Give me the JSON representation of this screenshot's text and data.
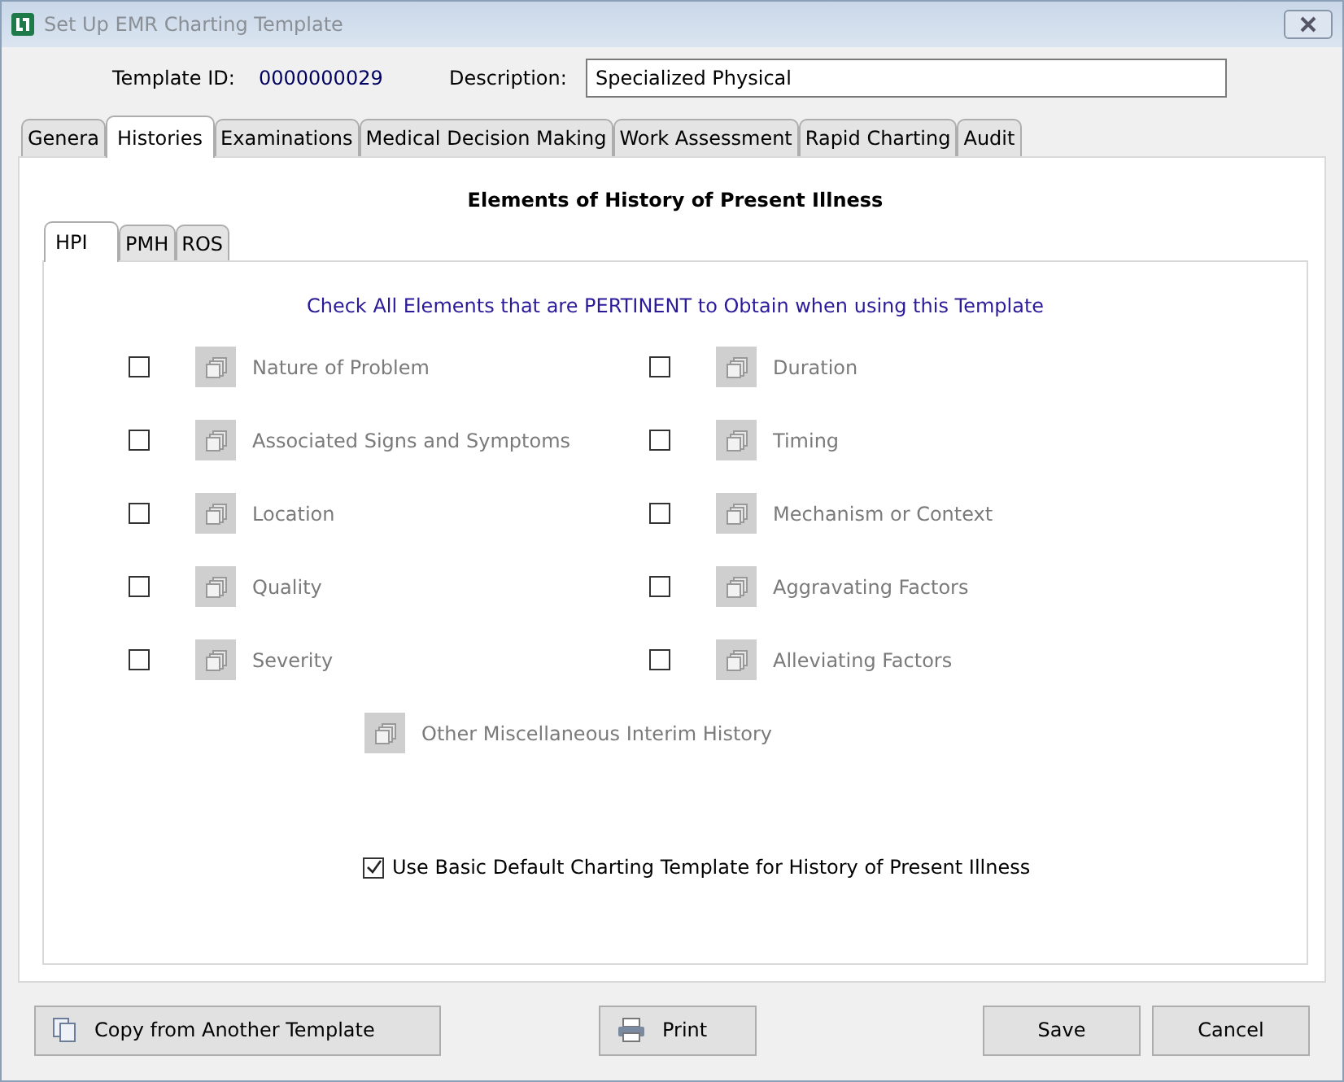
{
  "window": {
    "title": "Set Up EMR Charting Template"
  },
  "header": {
    "template_id_label": "Template ID:",
    "template_id": "0000000029",
    "description_label": "Description:",
    "description": "Specialized Physical"
  },
  "tabs": [
    {
      "label": "Genera",
      "selected": false
    },
    {
      "label": "Histories",
      "selected": true
    },
    {
      "label": "Examinations",
      "selected": false
    },
    {
      "label": "Medical Decision Making",
      "selected": false
    },
    {
      "label": "Work Assessment",
      "selected": false
    },
    {
      "label": "Rapid Charting",
      "selected": false
    },
    {
      "label": "Audit",
      "selected": false
    }
  ],
  "section_title": "Elements of History of Present Illness",
  "subtabs": [
    {
      "label": "HPI",
      "selected": true
    },
    {
      "label": "PMH",
      "selected": false
    },
    {
      "label": "ROS",
      "selected": false
    }
  ],
  "instruction": "Check All Elements that are PERTINENT to Obtain when using this Template",
  "elements": [
    {
      "label": "Nature of Problem",
      "checked": false
    },
    {
      "label": "Duration",
      "checked": false
    },
    {
      "label": "Associated Signs and Symptoms",
      "checked": false
    },
    {
      "label": "Timing",
      "checked": false
    },
    {
      "label": "Location",
      "checked": false
    },
    {
      "label": "Mechanism or Context",
      "checked": false
    },
    {
      "label": "Quality",
      "checked": false
    },
    {
      "label": "Aggravating Factors",
      "checked": false
    },
    {
      "label": "Severity",
      "checked": false
    },
    {
      "label": "Alleviating Factors",
      "checked": false
    }
  ],
  "other_element": {
    "label": "Other Miscellaneous Interim History"
  },
  "default_option": {
    "label": "Use Basic Default Charting Template for History of Present Illness",
    "checked": true
  },
  "buttons": [
    {
      "kind": "copy",
      "label": "Copy from Another Template"
    },
    {
      "kind": "print",
      "label": "Print"
    },
    {
      "kind": "save",
      "label": "Save"
    },
    {
      "kind": "cancel",
      "label": "Cancel"
    }
  ]
}
